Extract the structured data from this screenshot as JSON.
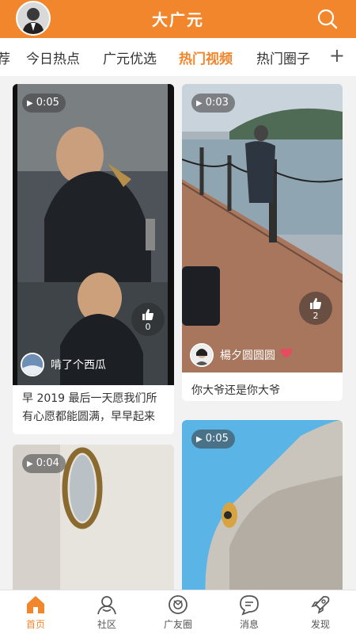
{
  "header": {
    "title": "大广元"
  },
  "tabs": [
    {
      "label": "荐"
    },
    {
      "label": "今日热点"
    },
    {
      "label": "广元优选"
    },
    {
      "label": "热门视频"
    },
    {
      "label": "热门圈子"
    }
  ],
  "tab_add": "+",
  "cards": [
    {
      "duration": "0:05",
      "likes": "0",
      "author": "啃了个西瓜",
      "caption": "早 2019 最后一天愿我们所有心愿都能圆满，早早起来"
    },
    {
      "duration": "0:03",
      "likes": "2",
      "author": "楊夕圆圆圆",
      "caption": "你大爷还是你大爷"
    },
    {
      "duration": "0:04"
    },
    {
      "duration": "0:05"
    }
  ],
  "nav": [
    {
      "label": "首页"
    },
    {
      "label": "社区"
    },
    {
      "label": "广友圈"
    },
    {
      "label": "消息"
    },
    {
      "label": "发现"
    }
  ],
  "colors": {
    "accent": "#f2862c",
    "background": "#f2f2f2"
  }
}
